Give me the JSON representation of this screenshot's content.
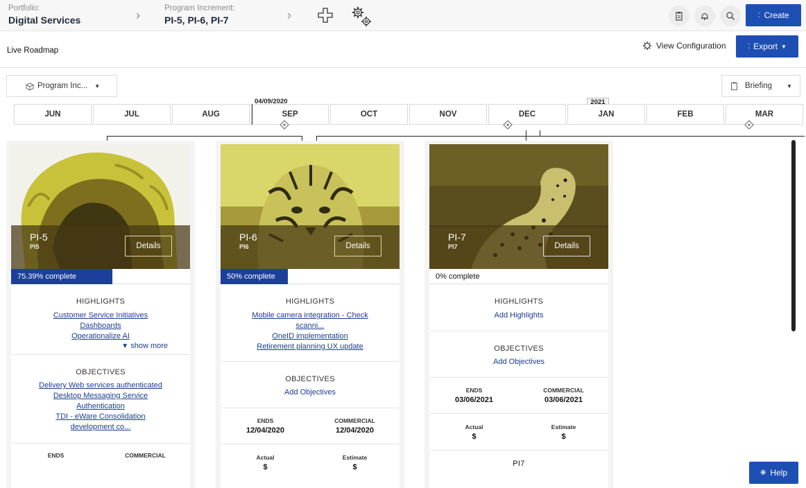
{
  "topbar": {
    "portfolio_label": "Portfolio:",
    "portfolio_value": "Digital Services",
    "pi_label": "Program Increment:",
    "pi_value": "PI-5, PI-6, PI-7",
    "create_label": "Create"
  },
  "subheader": {
    "title": "Live Roadmap",
    "view_config": "View Configuration",
    "export_label": "Export"
  },
  "filters": {
    "program_increment": "Program Inc...",
    "briefing": "Briefing"
  },
  "timeline": {
    "date_marker": "04/09/2020",
    "year_badge": "2021",
    "months": [
      "JUN",
      "JUL",
      "AUG",
      "SEP",
      "OCT",
      "NOV",
      "DEC",
      "JAN",
      "FEB",
      "MAR"
    ]
  },
  "cards": [
    {
      "name": "PI-5",
      "code": "PI5",
      "details_label": "Details",
      "progress": 75.39,
      "progress_text": "75.39% complete",
      "highlights_title": "HIGHLIGHTS",
      "highlights": [
        "Customer Service Initiatives",
        "Dashboards",
        "Operationalize AI"
      ],
      "show_more": "show more",
      "objectives_title": "OBJECTIVES",
      "objectives": [
        "Delivery Web services authenticated",
        "Desktop Messaging Service",
        "Authentication",
        "TDI - eWare Consolidation",
        "development co..."
      ],
      "ends_label": "ENDS",
      "commercial_label": "COMMERCIAL"
    },
    {
      "name": "PI-6",
      "code": "PI6",
      "details_label": "Details",
      "progress": 50,
      "progress_text": "50% complete",
      "highlights_title": "HIGHLIGHTS",
      "highlights": [
        "Mobile camera integration - Check",
        "scanni...",
        "OneID implementation",
        "Retirement planning UX update"
      ],
      "objectives_title": "OBJECTIVES",
      "add_objectives": "Add Objectives",
      "ends_label": "ENDS",
      "ends_value": "12/04/2020",
      "commercial_label": "COMMERCIAL",
      "commercial_value": "12/04/2020",
      "actual_label": "Actual",
      "actual_value": "$",
      "estimate_label": "Estimate",
      "estimate_value": "$"
    },
    {
      "name": "PI-7",
      "code": "PI7",
      "details_label": "Details",
      "progress": 0,
      "progress_text": "0% complete",
      "highlights_title": "HIGHLIGHTS",
      "add_highlights": "Add Highlights",
      "objectives_title": "OBJECTIVES",
      "add_objectives": "Add Objectives",
      "ends_label": "ENDS",
      "ends_value": "03/06/2021",
      "commercial_label": "COMMERCIAL",
      "commercial_value": "03/06/2021",
      "actual_label": "Actual",
      "actual_value": "$",
      "estimate_label": "Estimate",
      "estimate_value": "$",
      "footer_code": "PI7"
    }
  ],
  "help_label": "Help",
  "colors": {
    "primary_button": "#1d4fb3",
    "progress_fill": "#1b3f9a",
    "link": "#1a3c8f"
  }
}
